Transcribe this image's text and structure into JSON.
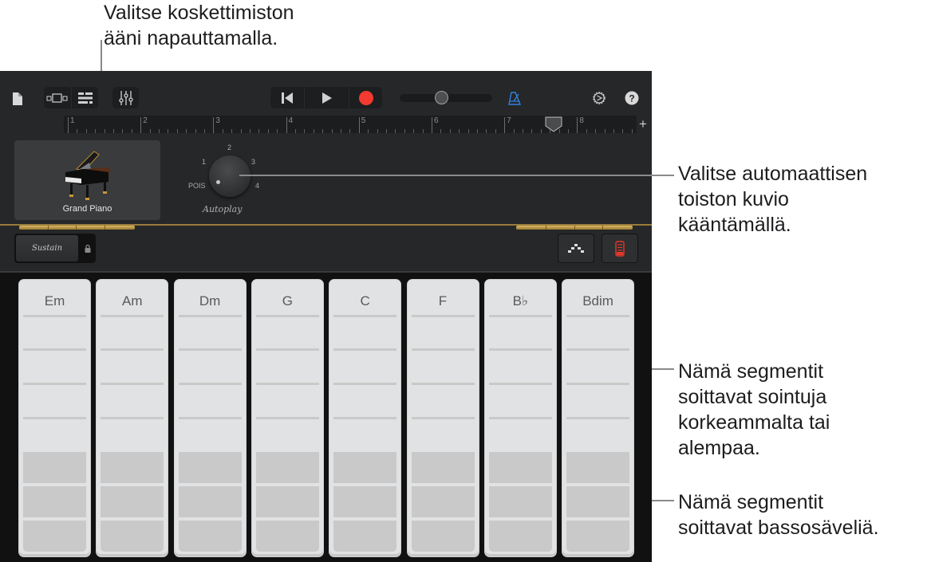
{
  "callouts": {
    "instrument": "Valitse koskettimiston\nääni napauttamalla.",
    "autoplay": "Valitse automaattisen\ntoiston kuvio\nkääntämällä.",
    "chord_strips": "Nämä segmentit\nsoittavat sointuja\nkorkeammalta tai\nalempaa.",
    "bass_strips": "Nämä segmentit\nsoittavat bassosäveliä."
  },
  "toolbar": {
    "icons": {
      "my_songs": "document-icon",
      "tracks_view": "tracks-view-icon",
      "instrument_view": "list-view-icon",
      "mixer": "mixer-sliders-icon",
      "go_to_beginning": "skip-back-icon",
      "play": "play-icon",
      "record": "record-icon",
      "metronome": "metronome-icon",
      "settings": "settings-gear-icon",
      "help": "help-icon"
    },
    "master_volume": 0.45,
    "record_color": "#f23a31",
    "metronome_color": "#2f80e0"
  },
  "ruler": {
    "bars": [
      "1",
      "2",
      "3",
      "4",
      "5",
      "6",
      "7",
      "8"
    ],
    "add_section_label": "+"
  },
  "instrument": {
    "name": "Grand Piano"
  },
  "autoplay": {
    "label": "Autoplay",
    "positions": [
      "POIS",
      "1",
      "2",
      "3",
      "4"
    ],
    "selected": "POIS"
  },
  "controls": {
    "sustain_label": "Sustain",
    "accent_color": "#e0392b"
  },
  "chords": [
    {
      "name": "Em"
    },
    {
      "name": "Am"
    },
    {
      "name": "Dm"
    },
    {
      "name": "G"
    },
    {
      "name": "C"
    },
    {
      "name": "F"
    },
    {
      "name": "B♭"
    },
    {
      "name": "Bdim"
    }
  ]
}
